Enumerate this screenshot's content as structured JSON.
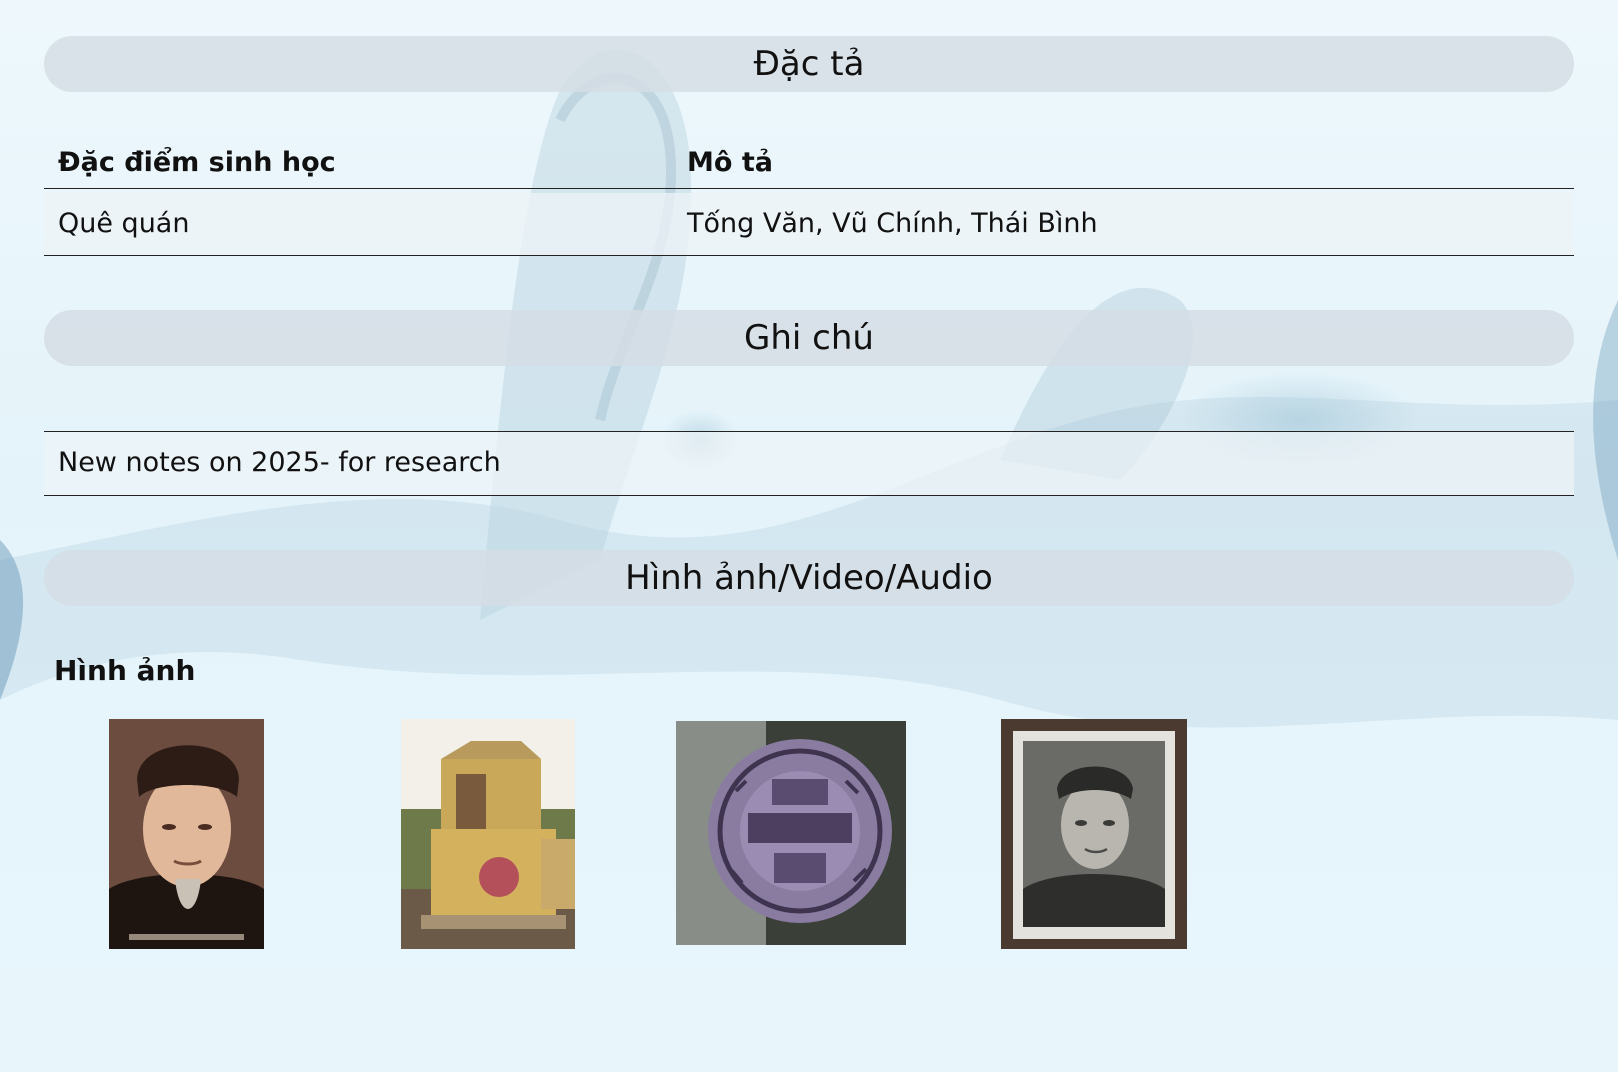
{
  "sections": {
    "spec_title": "Đặc tả",
    "notes_title": "Ghi chú",
    "media_title": "Hình ảnh/Video/Audio"
  },
  "spec_table": {
    "headers": [
      "Đặc điểm sinh học",
      "Mô tả"
    ],
    "rows": [
      {
        "feature": "Quê quán",
        "description": "Tống Văn, Vũ Chính, Thái Bình"
      }
    ]
  },
  "notes": {
    "text": "New notes on 2025- for research"
  },
  "media": {
    "images_heading": "Hình ảnh",
    "images": [
      {
        "depicts": "portrait photo of elderly man in turban"
      },
      {
        "depicts": "family tomb / shrine"
      },
      {
        "depicts": "round seal stamp"
      },
      {
        "depicts": "black-and-white portrait photo"
      }
    ]
  },
  "colors": {
    "header_pill": "#d4dde4",
    "background": "#e6f5fb",
    "row_fill": "#eef3f7"
  }
}
